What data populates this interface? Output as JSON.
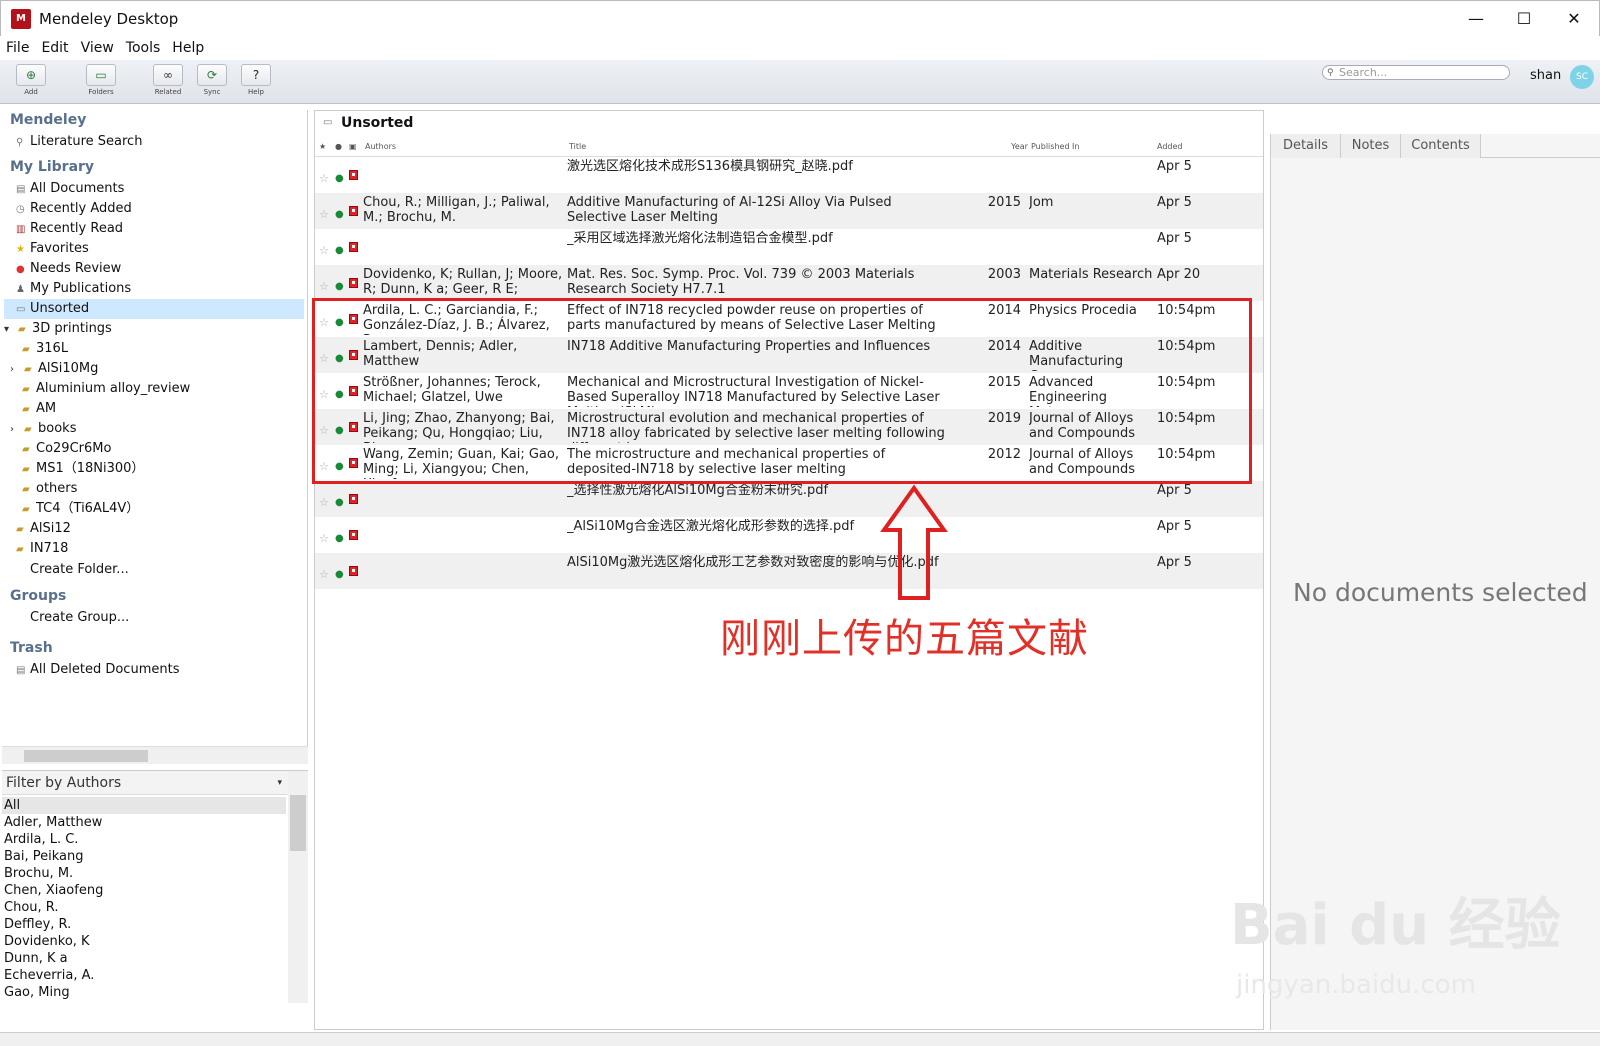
{
  "window": {
    "title": "Mendeley Desktop",
    "logo": "M",
    "min": "—",
    "max": "☐",
    "close": "✕"
  },
  "menu": [
    "File",
    "Edit",
    "View",
    "Tools",
    "Help"
  ],
  "toolbar": {
    "buttons": [
      {
        "label": "Add",
        "icon": "add-document-icon"
      },
      {
        "label": "Folders",
        "icon": "new-folder-icon"
      },
      {
        "label": "Related",
        "icon": "related-icon"
      },
      {
        "label": "Sync",
        "icon": "sync-icon"
      },
      {
        "label": "Help",
        "icon": "help-icon"
      }
    ],
    "search_placeholder": "Search...",
    "user": "shan",
    "avatar": "SC"
  },
  "sidebar": {
    "mendeley_heading": "Mendeley",
    "literature_search": "Literature Search",
    "library_heading": "My Library",
    "library_items": [
      "All Documents",
      "Recently Added",
      "Recently Read",
      "Favorites",
      "Needs Review",
      "My Publications",
      "Unsorted"
    ],
    "folders": [
      "3D printings",
      "316L",
      "AlSi10Mg",
      "Aluminium alloy_review",
      "AM",
      "books",
      "Co29Cr6Mo",
      "MS1（18Ni300）",
      "others",
      "TC4（Ti6AL4V）",
      "AlSi12",
      "IN718",
      "Create Folder..."
    ],
    "groups_heading": "Groups",
    "create_group": "Create Group...",
    "trash_heading": "Trash",
    "deleted": "All Deleted Documents"
  },
  "filter": {
    "label": "Filter by Authors",
    "authors": [
      "All",
      "Adler, Matthew",
      "Ardila, L. C.",
      "Bai, Peikang",
      "Brochu, M.",
      "Chen, Xiaofeng",
      "Chou, R.",
      "Deffley, R.",
      "Dovidenko, K",
      "Dunn, K a",
      "Echeverria, A.",
      "Gao, Ming"
    ]
  },
  "main": {
    "title": "Unsorted",
    "columns": {
      "authors": "Authors",
      "title": "Title",
      "year": "Year",
      "published": "Published In",
      "added": "Added"
    },
    "rows": [
      {
        "authors": "",
        "title": "激光选区熔化技术成形S136模具钢研究_赵晓.pdf",
        "year": "",
        "published": "",
        "added": "Apr 5"
      },
      {
        "authors": "Chou, R.; Milligan, J.; Paliwal, M.; Brochu, M.",
        "title": "Additive Manufacturing of Al-12Si Alloy Via Pulsed Selective Laser Melting",
        "year": "2015",
        "published": "Jom",
        "added": "Apr 5"
      },
      {
        "authors": "",
        "title": "_采用区域选择激光熔化法制造铝合金模型.pdf",
        "year": "",
        "published": "",
        "added": "Apr 5"
      },
      {
        "authors": "Dovidenko, K; Rullan, J; Moore, R; Dunn, K a; Geer, R E; Heuchlin...",
        "title": "Mat. Res. Soc. Symp. Proc. Vol. 739 © 2003 Materials Research Society H7.7.1",
        "year": "2003",
        "published": "Materials Research",
        "added": "Apr 20"
      },
      {
        "authors": "Ardila, L. C.; Garciandia, F.; González-Díaz, J. B.; Álvarez, P....",
        "title": "Effect of IN718 recycled powder reuse on properties of parts manufactured by means of Selective Laser Melting",
        "year": "2014",
        "published": "Physics Procedia",
        "added": "10:54pm"
      },
      {
        "authors": "Lambert, Dennis; Adler, Matthew",
        "title": "IN718 Additive Manufacturing Properties and Influences",
        "year": "2014",
        "published": "Additive Manufacturing Co...",
        "added": "10:54pm"
      },
      {
        "authors": "Strößner, Johannes; Terock, Michael; Glatzel, Uwe",
        "title": "Mechanical and Microstructural Investigation of Nickel-Based Superalloy IN718 Manufactured by Selective Laser Melting (SLM)",
        "year": "2015",
        "published": "Advanced Engineering Mater...",
        "added": "10:54pm"
      },
      {
        "authors": "Li, Jing; Zhao, Zhanyong; Bai, Peikang; Qu, Hongqiao; Liu, Bin...",
        "title": "Microstructural evolution and mechanical properties of IN718 alloy fabricated by selective laser melting following different he...",
        "year": "2019",
        "published": "Journal of Alloys and Compounds",
        "added": "10:54pm"
      },
      {
        "authors": "Wang, Zemin; Guan, Kai; Gao, Ming; Li, Xiangyou; Chen, Xiaof...",
        "title": "The microstructure and mechanical properties of deposited-IN718 by selective laser melting",
        "year": "2012",
        "published": "Journal of Alloys and Compounds",
        "added": "10:54pm"
      },
      {
        "authors": "",
        "title": "_选择性激光熔化AlSi10Mg合金粉末研究.pdf",
        "year": "",
        "published": "",
        "added": "Apr 5"
      },
      {
        "authors": "",
        "title": "_AlSi10Mg合金选区激光熔化成形参数的选择.pdf",
        "year": "",
        "published": "",
        "added": "Apr 5"
      },
      {
        "authors": "",
        "title": "AlSi10Mg激光选区熔化成形工艺参数对致密度的影响与优化.pdf",
        "year": "",
        "published": "",
        "added": "Apr 5"
      }
    ]
  },
  "annotation": "刚刚上传的五篇文献",
  "details": {
    "tabs": [
      "Details",
      "Notes",
      "Contents"
    ],
    "empty": "No documents selected"
  },
  "watermark": {
    "brand": "Bai du 经验",
    "url": "jingyan.baidu.com"
  },
  "colors": {
    "accent": "#58708c",
    "highlight": "#e02020",
    "selected": "#cde8ff"
  }
}
